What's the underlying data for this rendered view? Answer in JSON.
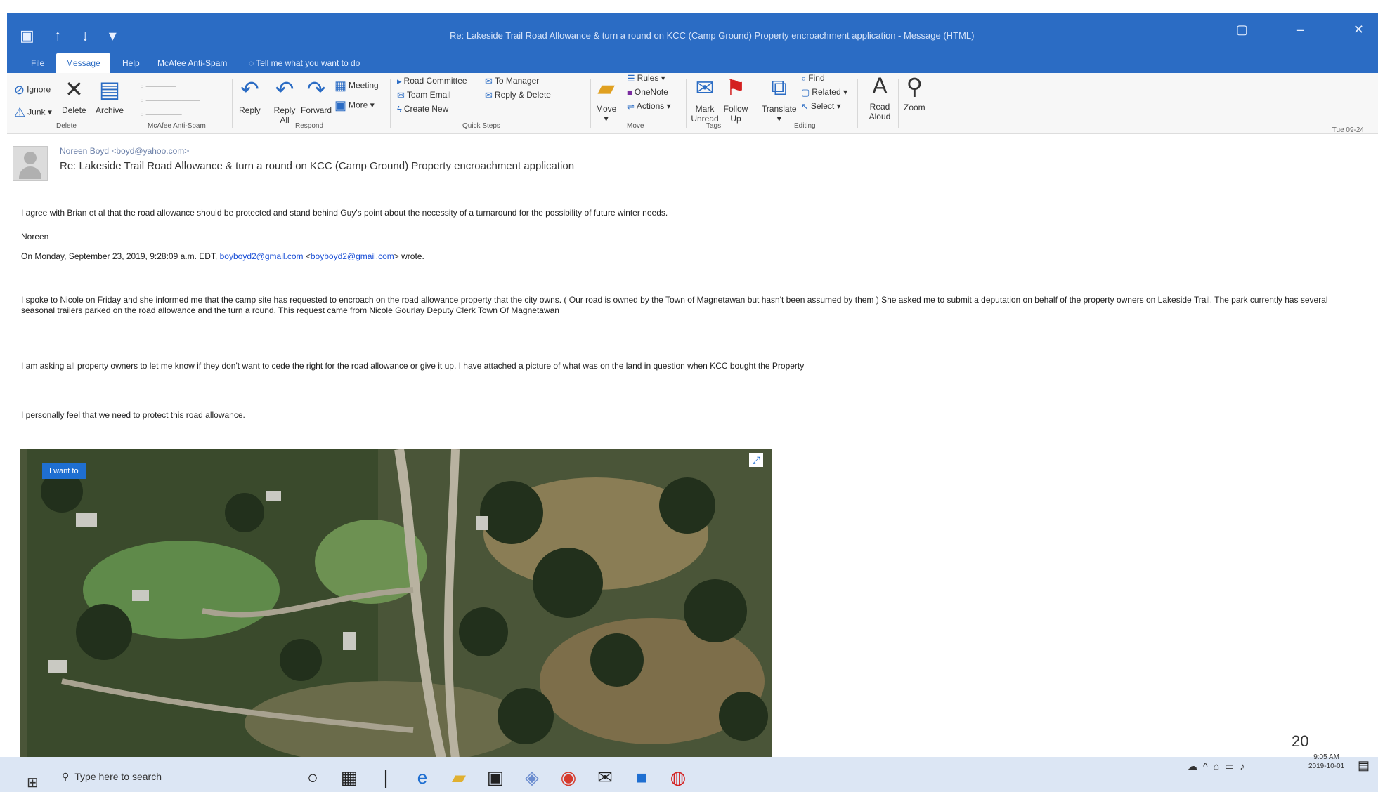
{
  "window": {
    "title": "Re: Lakeside Trail Road Allowance & turn a round on KCC (Camp Ground) Property encroachment application - Message (HTML)",
    "qat_icons": [
      "save-icon",
      "up-arrow-icon",
      "down-arrow-icon",
      "more-icon"
    ],
    "controls": [
      "▢",
      "–",
      "✕"
    ]
  },
  "tabs": [
    "File",
    "Message",
    "Help",
    "McAfee Anti-Spam",
    "Tell me what you want to do"
  ],
  "ribbon": {
    "delete_group": {
      "ignore": "Ignore",
      "junk": "Junk",
      "delete": "Delete",
      "archive": "Archive",
      "label": "Delete"
    },
    "mcafee_group": {
      "label": "McAfee Anti-Spam"
    },
    "respond_group": {
      "reply": "Reply",
      "reply_all": "Reply All",
      "forward": "Forward",
      "meeting": "Meeting",
      "more": "More",
      "label": "Respond"
    },
    "quicksteps_group": {
      "items": [
        "Road Committee",
        "Team Email",
        "Create New",
        "To Manager",
        "Reply & Delete"
      ],
      "label": "Quick Steps"
    },
    "move_group": {
      "move": "Move",
      "rules": "Rules",
      "onenote": "OneNote",
      "actions": "Actions",
      "label": "Move"
    },
    "tags_group": {
      "mark_unread": "Mark Unread",
      "follow_up": "Follow Up",
      "label": "Tags"
    },
    "editing_group": {
      "translate": "Translate",
      "find": "Find",
      "related": "Related",
      "select": "Select",
      "label": "Editing"
    },
    "read_aloud": "Read Aloud",
    "zoom": "Zoom"
  },
  "message": {
    "from": "Noreen Boyd <boyd@yahoo.com>",
    "subject": "Re: Lakeside Trail Road Allowance & turn a round on KCC (Camp Ground) Property encroachment application",
    "date": "Tue 09-24",
    "body": {
      "p1": "I agree with Brian et al that the road allowance should be protected and stand behind Guy's point about the necessity of a turnaround for the possibility of future winter needs.",
      "signature": "Noreen",
      "quote_intro": "On Monday, September 23, 2019, 9:28:09 a.m. EDT,",
      "email1": "boyboyd2@gmail.com",
      "email2": "boyboyd2@gmail.com",
      "wrote": "> wrote.",
      "p2": "I spoke to Nicole on Friday and she informed me that the camp site has requested to encroach on the road allowance property that the city owns. ( Our road is owned by the Town of Magnetawan but hasn't been assumed by them ) She asked me to submit a deputation on behalf of the property owners on Lakeside Trail. The park currently has several seasonal trailers parked on the road allowance and the turn a round. This request came from Nicole Gourlay Deputy Clerk Town Of Magnetawan",
      "p3": "I am asking all property owners to let me know if they don't want to cede the right for the road allowance or give it up. I have attached a picture of what was on the land in question when KCC bought the Property",
      "p4": "I personally feel that we need to protect this road allowance."
    },
    "map_label": "I want to"
  },
  "page_number": "20",
  "taskbar": {
    "search_placeholder": "Type here to search",
    "apps": [
      "cortana-icon",
      "task-view-icon",
      "divider-icon",
      "edge-icon",
      "file-explorer-icon",
      "store-icon",
      "shield-icon",
      "chrome-icon",
      "mail-icon",
      "outlook-icon",
      "acrobat-icon"
    ],
    "clock_time": "9:05 AM",
    "clock_date": "2019-10-01"
  }
}
